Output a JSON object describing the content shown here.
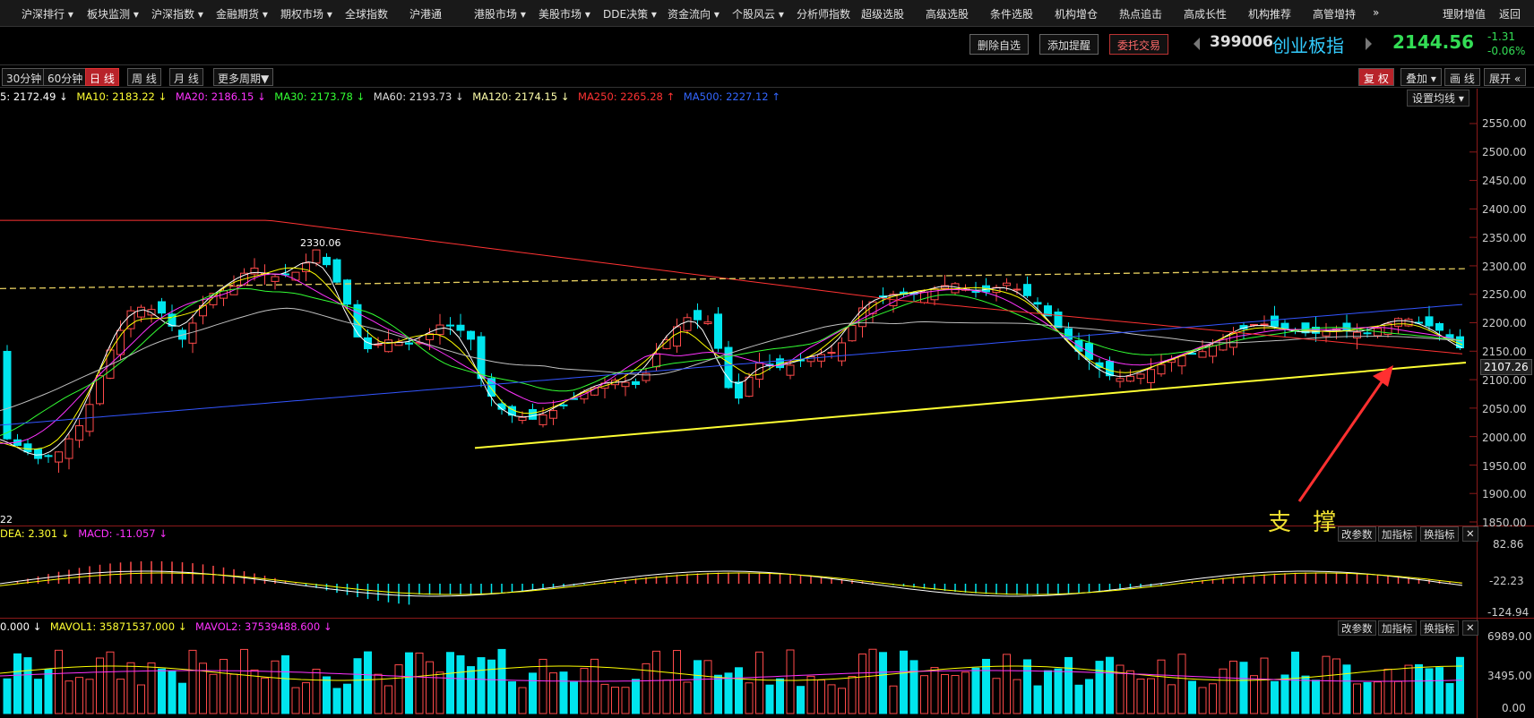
{
  "topnav": {
    "items": [
      "沪深排行 ▾",
      "板块监测 ▾",
      "沪深指数 ▾",
      "金融期货 ▾",
      "期权市场 ▾",
      "全球指数",
      "沪港通",
      "港股市场 ▾",
      "美股市场 ▾",
      "DDE决策 ▾",
      "资金流向 ▾",
      "个股风云 ▾",
      "分析师指数",
      "超级选股",
      "高级选股",
      "条件选股",
      "机构增仓",
      "热点追击",
      "高成长性",
      "机构推荐",
      "高管增持",
      "»"
    ],
    "right": [
      "理财增值",
      "返回"
    ]
  },
  "toolbar": {
    "delete_label": "删除自选",
    "alert_label": "添加提醒",
    "trade_label": "委托交易"
  },
  "quote": {
    "code": "399006",
    "name": "创业板指",
    "price": "2144.56",
    "change": "-1.31",
    "change_pct": "-0.06%"
  },
  "periods": [
    "30分钟",
    "60分钟",
    "日 线",
    "周 线",
    "月 线",
    "更多周期▼"
  ],
  "period_active": 2,
  "right_buttons": [
    "复 权",
    "叠加 ▾",
    "画 线",
    "展开 «"
  ],
  "ma_values": {
    "ma5": "5: 2172.49 ↓",
    "ma10": "MA10: 2183.22 ↓",
    "ma20": "MA20: 2186.15 ↓",
    "ma30": "MA30: 2173.78 ↓",
    "ma60": "MA60: 2193.73 ↓",
    "ma120": "MA120: 2174.15 ↓",
    "ma250": "MA250: 2265.28 ↑",
    "ma500": "MA500: 2227.12 ↑"
  },
  "set_ma_label": "设置均线 ▾",
  "price_axis": [
    "2550.00",
    "2500.00",
    "2450.00",
    "2400.00",
    "2350.00",
    "2300.00",
    "2250.00",
    "2200.00",
    "2150.00",
    "2107.26",
    "2100.00",
    "2050.00",
    "2000.00",
    "1950.00",
    "1900.00",
    "1850.00"
  ],
  "current_price_tag": "2107.26",
  "high_label": "2330.06",
  "low_corner_label": "22",
  "macd": {
    "dea": "DEA: 2.301 ↓",
    "macd": "MACD: -11.057 ↓",
    "axis": [
      "82.86",
      "-22.23",
      "-124.94"
    ]
  },
  "vol": {
    "v0": "0.000 ↓",
    "mavol1": "MAVOL1: 35871537.000 ↓",
    "mavol2": "MAVOL2: 37539488.600 ↓",
    "axis": [
      "6989.00",
      "3495.00",
      "0.00"
    ]
  },
  "indicator_buttons": [
    "改参数",
    "加指标",
    "换指标",
    "✕"
  ],
  "annotation": "支 撑",
  "colors": {
    "up": "#ff4a4a",
    "down": "#00e5ee",
    "ma5": "#ffffff",
    "ma10": "#ffff00",
    "ma20": "#ff33ff",
    "ma30": "#33ff33",
    "ma60": "#c0c0c0",
    "ma250": "#ff3333",
    "ma500": "#3355ff",
    "support": "#ffff33",
    "accent_red": "#b8232a"
  }
}
